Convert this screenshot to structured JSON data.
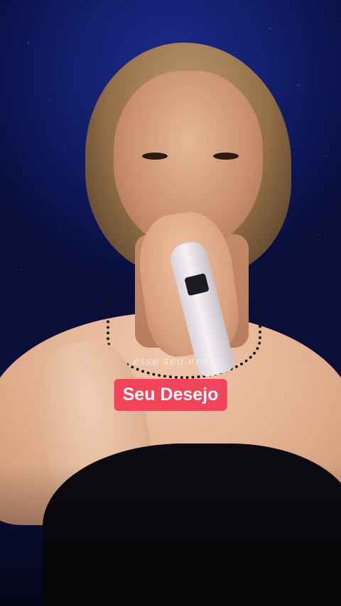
{
  "video": {
    "lyric_line": "esse seu ero",
    "title_badge": "Seu Desejo"
  },
  "colors": {
    "badge_background": "#f2445a",
    "badge_text": "#ffffff",
    "backdrop": "#14206e"
  }
}
